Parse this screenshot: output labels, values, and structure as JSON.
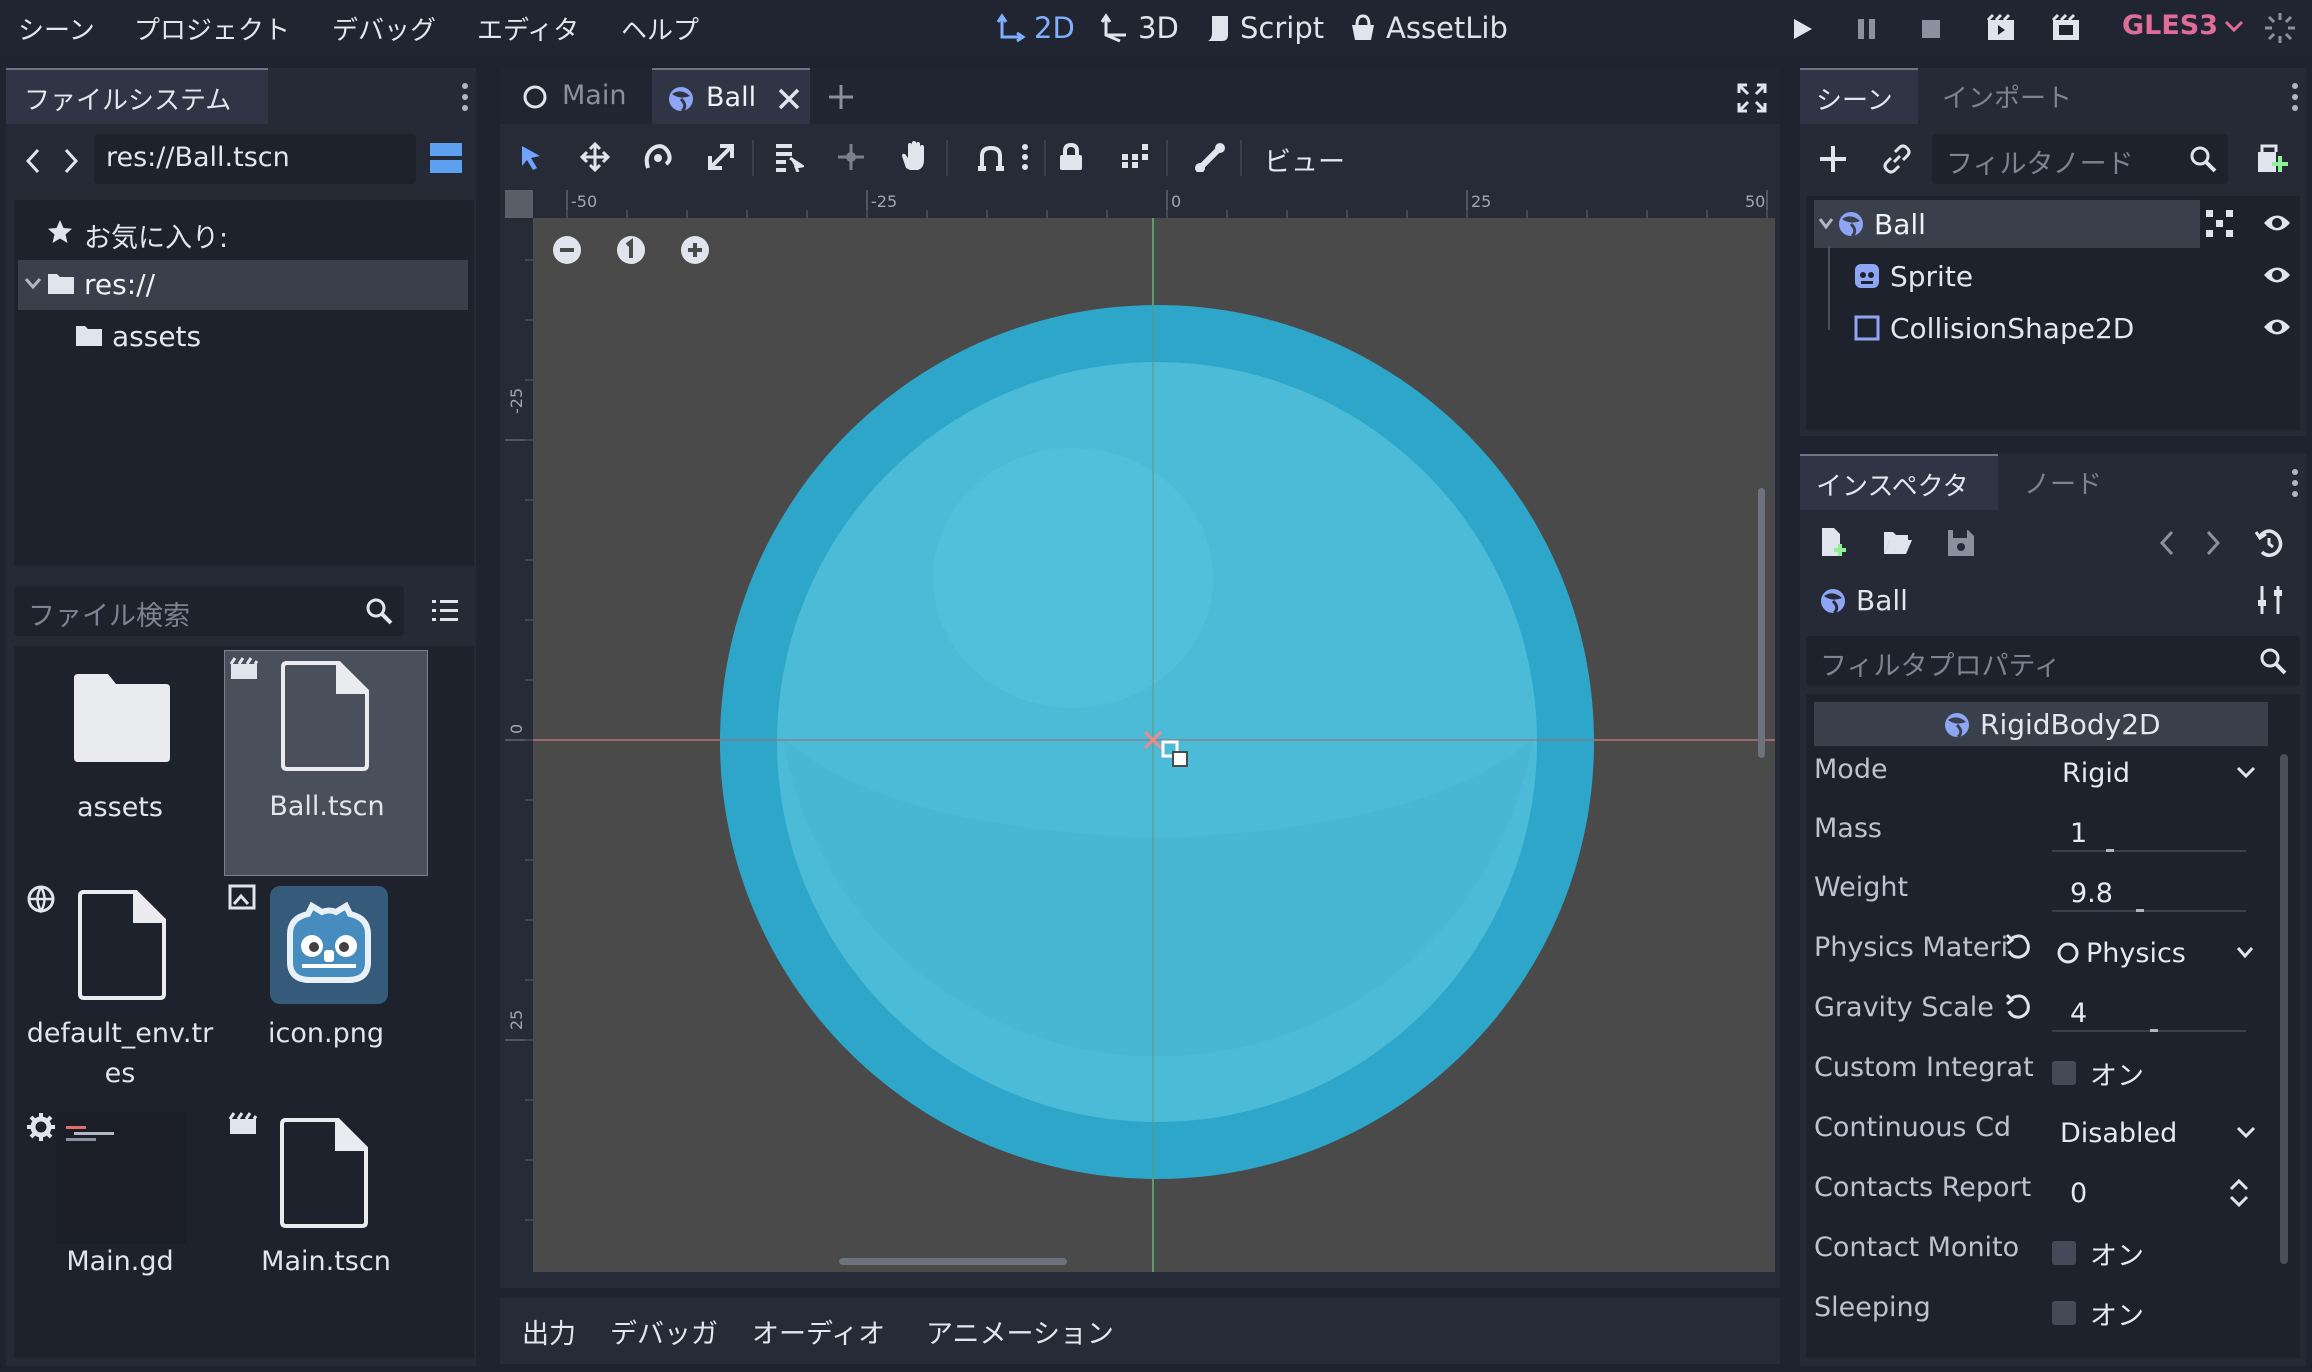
{
  "menubar": {
    "items": [
      "シーン",
      "プロジェクト",
      "デバッグ",
      "エディタ",
      "ヘルプ"
    ],
    "workspaces": [
      {
        "label": "2D",
        "icon": "2d-arrows-icon",
        "active": true
      },
      {
        "label": "3D",
        "icon": "3d-arrows-icon",
        "active": false
      },
      {
        "label": "Script",
        "icon": "script-icon",
        "active": false
      },
      {
        "label": "AssetLib",
        "icon": "assetlib-icon",
        "active": false
      }
    ],
    "renderer": "GLES3"
  },
  "filesystem": {
    "tabs": [
      "ファイルシステム"
    ],
    "path": "res://Ball.tscn",
    "tree": {
      "favorites": "お気に入り:",
      "root": "res://",
      "children": [
        "assets"
      ]
    },
    "search_placeholder": "ファイル検索",
    "files": [
      {
        "name": "assets",
        "type": "folder"
      },
      {
        "name": "Ball.tscn",
        "type": "scene",
        "selected": true
      },
      {
        "name": "default_env.tr\nes",
        "line1": "default_env.tr",
        "line2": "es",
        "type": "resource"
      },
      {
        "name": "icon.png",
        "type": "image"
      },
      {
        "name": "Main.gd",
        "type": "script"
      },
      {
        "name": "Main.tscn",
        "type": "scene"
      }
    ]
  },
  "editor": {
    "tabs": [
      {
        "label": "Main",
        "active": false
      },
      {
        "label": "Ball",
        "active": true
      }
    ],
    "view_menu": "ビュー",
    "ruler_h": [
      "-50",
      "-25",
      "0",
      "25",
      "50"
    ],
    "ruler_v": [
      "-25",
      "0",
      "25"
    ]
  },
  "bottom_panel": {
    "tabs": [
      "出力",
      "デバッガ",
      "オーディオ",
      "アニメーション"
    ]
  },
  "scene_dock": {
    "tabs": [
      "シーン",
      "インポート"
    ],
    "filter_placeholder": "フィルタノード",
    "nodes": [
      {
        "label": "Ball",
        "icon": "rigidbody-icon",
        "selected": true
      },
      {
        "label": "Sprite",
        "icon": "sprite-icon"
      },
      {
        "label": "CollisionShape2D",
        "icon": "collision-shape-icon"
      }
    ]
  },
  "inspector": {
    "tabs": [
      "インスペクタ",
      "ノード"
    ],
    "object_name": "Ball",
    "filter_placeholder": "フィルタプロパティ",
    "class_header": "RigidBody2D",
    "properties": [
      {
        "label": "Mode",
        "value": "Rigid",
        "kind": "dropdown"
      },
      {
        "label": "Mass",
        "value": "1",
        "kind": "number"
      },
      {
        "label": "Weight",
        "value": "9.8",
        "kind": "number"
      },
      {
        "label": "Physics Materi",
        "value": "Physics",
        "kind": "resource"
      },
      {
        "label": "Gravity Scale",
        "value": "4",
        "kind": "number"
      },
      {
        "label": "Custom Integrat",
        "value": "オン",
        "kind": "check"
      },
      {
        "label": "Continuous Cd",
        "value": "Disabled",
        "kind": "dropdown"
      },
      {
        "label": "Contacts Report",
        "value": "0",
        "kind": "spin"
      },
      {
        "label": "Contact Monito",
        "value": "オン",
        "kind": "check"
      },
      {
        "label": "Sleeping",
        "value": "オン",
        "kind": "check"
      }
    ]
  },
  "colors": {
    "accent": "#7eb0ff",
    "ball_outer": "#2ea6c9",
    "ball_inner": "#4bbbd8",
    "renderer": "#e06c9a"
  }
}
